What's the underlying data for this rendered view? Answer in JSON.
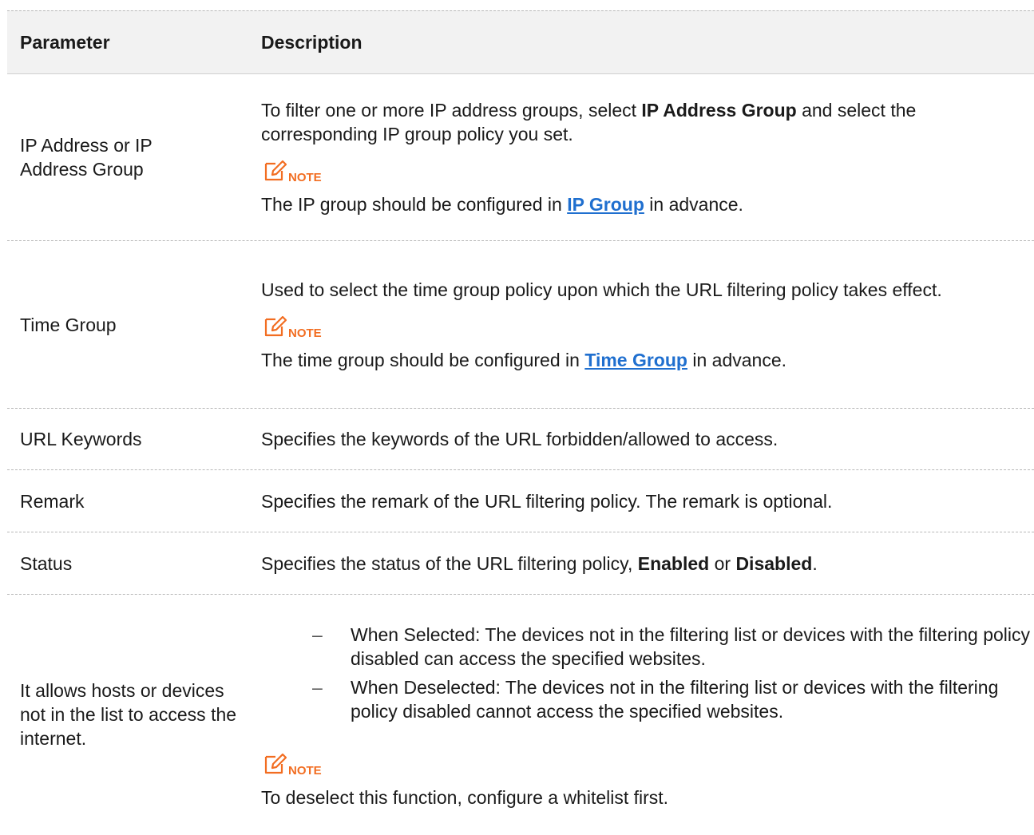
{
  "header": {
    "param": "Parameter",
    "desc": "Description"
  },
  "rows": [
    {
      "param": "IP Address or IP Address Group",
      "desc_prefix": "To filter one or more IP address groups, select ",
      "desc_bold": "IP Address Group",
      "desc_suffix": " and select the corresponding IP group policy you set.",
      "note_label": "NOTE",
      "note_prefix": "The IP group should be configured in ",
      "note_link": "IP Group",
      "note_suffix": " in advance."
    },
    {
      "param": "Time Group",
      "desc": "Used to select the time group policy upon which the URL filtering policy takes effect.",
      "note_label": "NOTE",
      "note_prefix": "The time group should be configured in ",
      "note_link": "Time Group",
      "note_suffix": " in advance."
    },
    {
      "param": "URL Keywords",
      "desc": "Specifies the keywords of the URL forbidden/allowed to access."
    },
    {
      "param": "Remark",
      "desc": "Specifies the remark of the URL filtering policy. The remark is optional."
    },
    {
      "param": "Status",
      "desc_prefix": "Specifies the status of the URL filtering policy, ",
      "desc_bold1": "Enabled",
      "desc_mid": " or ",
      "desc_bold2": "Disabled",
      "desc_suffix": "."
    },
    {
      "param": "It allows hosts or devices not in the list to access the internet.",
      "bullets": [
        "When Selected: The devices not in the filtering list or devices with the filtering policy disabled can access the specified websites.",
        "When Deselected: The devices not in the filtering list or devices with the filtering policy disabled cannot access the specified websites."
      ],
      "bullet_marker": "–",
      "note_label": "NOTE",
      "note_text": "To deselect this function, configure a whitelist first."
    }
  ],
  "colors": {
    "link": "#1f6fcf",
    "note": "#f26d21",
    "header_bg": "#f2f2f2"
  },
  "icons": {
    "note": "edit-pencil-icon"
  }
}
